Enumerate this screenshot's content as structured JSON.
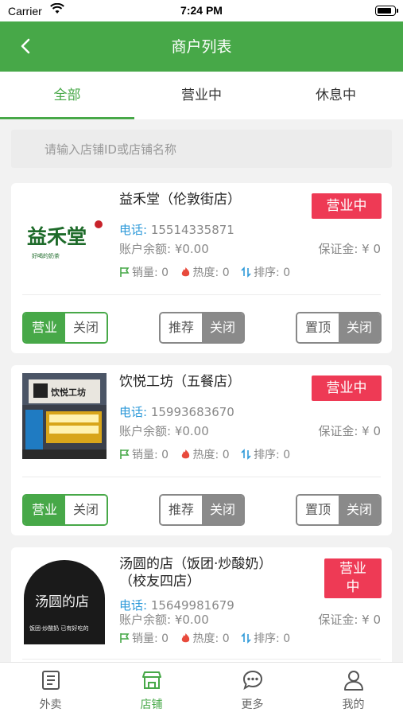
{
  "status_bar": {
    "carrier": "Carrier",
    "time": "7:24 PM"
  },
  "nav": {
    "title": "商户列表"
  },
  "tabs": [
    {
      "label": "全部",
      "active": true
    },
    {
      "label": "营业中",
      "active": false
    },
    {
      "label": "休息中",
      "active": false
    }
  ],
  "search": {
    "placeholder": "请输入店铺ID或店铺名称"
  },
  "shops": [
    {
      "name": "益禾堂（伦敦街店）",
      "status": "营业中",
      "phone_label": "电话:",
      "phone": "15514335871",
      "balance": "账户余额: ¥0.00",
      "deposit": "保证金: ¥ 0",
      "sales": "销量: 0",
      "heat": "热度: 0",
      "rank": "排序: 0",
      "logo_text": "益禾堂",
      "logo_sub": "好喝的奶茶",
      "open_label": "营业",
      "close_label": "关闭",
      "recommend_label": "推荐",
      "recommend_off": "关闭",
      "pin_label": "置顶",
      "pin_off": "关闭"
    },
    {
      "name": "饮悦工坊（五餐店）",
      "status": "营业中",
      "phone_label": "电话:",
      "phone": "15993683670",
      "balance": "账户余额: ¥0.00",
      "deposit": "保证金: ¥ 0",
      "sales": "销量: 0",
      "heat": "热度: 0",
      "rank": "排序: 0",
      "logo_text": "饮悦工坊",
      "open_label": "营业",
      "close_label": "关闭",
      "recommend_label": "推荐",
      "recommend_off": "关闭",
      "pin_label": "置顶",
      "pin_off": "关闭"
    },
    {
      "name_line1": "汤圆的店（饭团·炒酸奶）",
      "name_line2": "（校友四店）",
      "status_line1": "营业",
      "status_line2": "中",
      "phone_label": "电话:",
      "phone": "15649981679",
      "balance": "账户余额: ¥0.00",
      "deposit": "保证金: ¥ 0",
      "sales": "销量: 0",
      "heat": "热度: 0",
      "rank": "排序: 0",
      "logo_text": "汤圆的店",
      "logo_sub": "饭团·炒酸奶 已有好吃的"
    }
  ],
  "bottom_tabs": [
    {
      "label": "外卖",
      "icon": "list-icon",
      "active": false
    },
    {
      "label": "店铺",
      "icon": "store-icon",
      "active": true
    },
    {
      "label": "更多",
      "icon": "chat-more-icon",
      "active": false
    },
    {
      "label": "我的",
      "icon": "person-icon",
      "active": false
    }
  ],
  "colors": {
    "primary": "#47a848",
    "status_red": "#ee3a55",
    "phone_blue": "#2f9ad9",
    "heat_red": "#e84a3c"
  }
}
